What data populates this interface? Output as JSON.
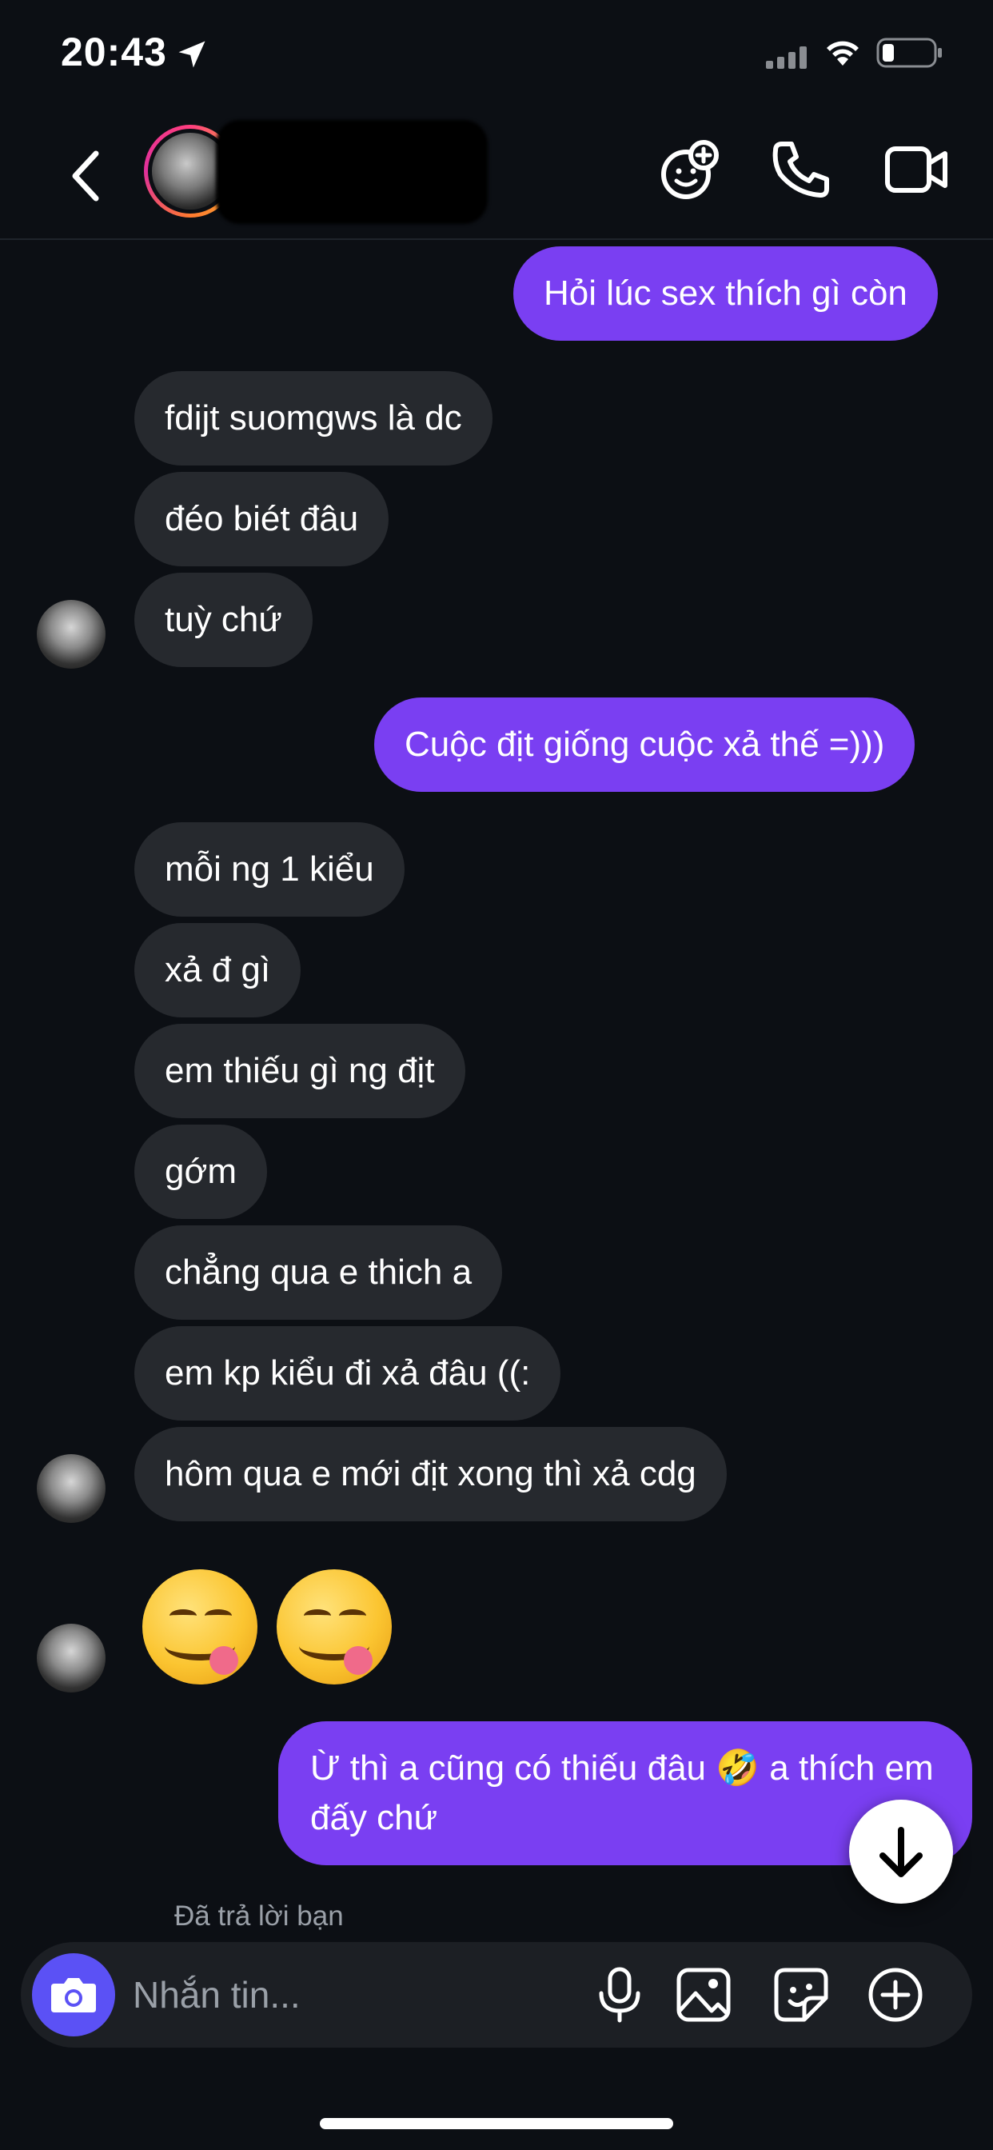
{
  "status_bar": {
    "time": "20:43"
  },
  "header": {
    "back_label": "back",
    "contact_name": ""
  },
  "messages": {
    "m1": "Hỏi lúc sex thích gì còn",
    "m2": "fdijt suomgws là dc",
    "m3": "đéo biét đâu",
    "m4": "tuỳ chứ",
    "m5": "Cuộc địt giống cuộc xả thế =)))",
    "m6": "mỗi ng 1 kiểu",
    "m7": "xả đ gì",
    "m8": "em thiếu gì ng địt",
    "m9": "gớm",
    "m10": "chẳng qua e thich a",
    "m11": "em kp kiểu đi xả đâu ((:",
    "m12": "hôm qua e mới địt xong thì xả cdg",
    "m13": "Ừ thì a cũng có thiếu đâu 🤣 a thích em đấy chứ"
  },
  "emoji_message": {
    "count": 2,
    "emoji": "face-savoring-food"
  },
  "reply_status": "Đã trả lời bạn",
  "composer": {
    "placeholder": "Nhắn tin..."
  },
  "colors": {
    "outgoing": "#7a3ff2",
    "incoming": "#26292e",
    "background": "#0c0f14",
    "camera": "#5b51f5"
  }
}
